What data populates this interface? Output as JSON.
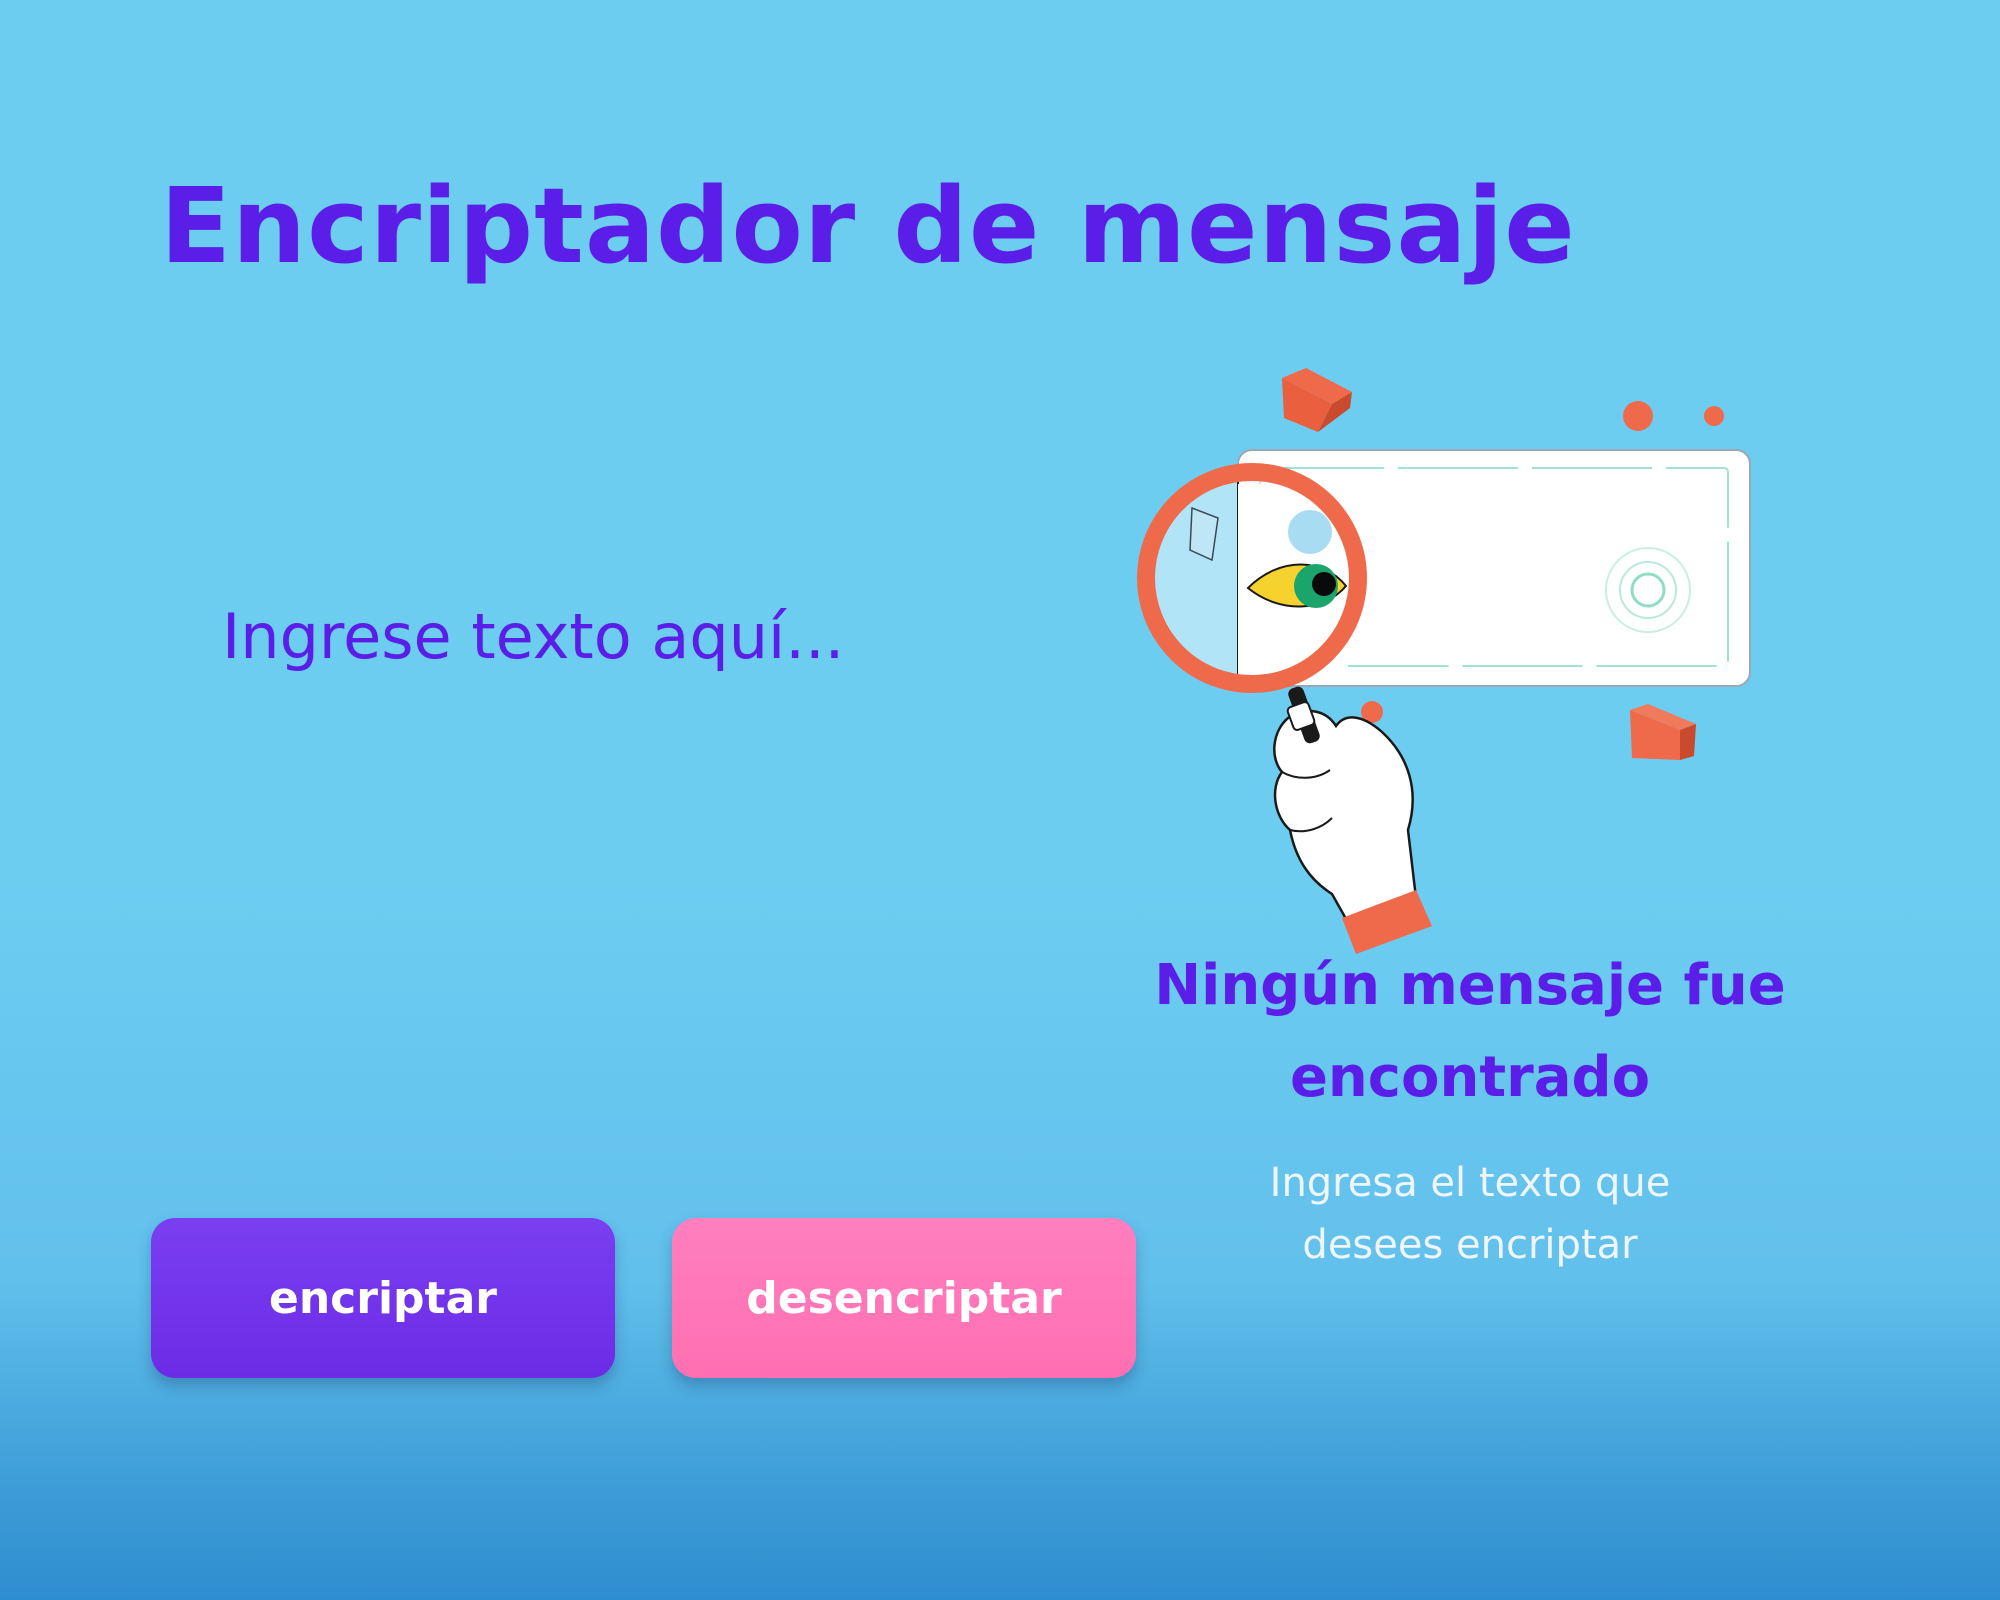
{
  "app": {
    "title": "Encriptador de mensaje"
  },
  "input": {
    "placeholder": "Ingrese texto aquí...",
    "value": ""
  },
  "buttons": {
    "encrypt_label": "encriptar",
    "decrypt_label": "desencriptar"
  },
  "output": {
    "empty_title": "Ningún mensaje fue encontrado",
    "empty_description": "Ingresa el texto que desees encriptar"
  },
  "icons": {
    "illustration": "magnifying-glass-search-illustration"
  },
  "colors": {
    "accent": "#5a1ee8",
    "encrypt_button": "#6c2be6",
    "decrypt_button": "#ff6fb2",
    "highlight": "#ef6a4b",
    "background": "#6dcdf1"
  }
}
